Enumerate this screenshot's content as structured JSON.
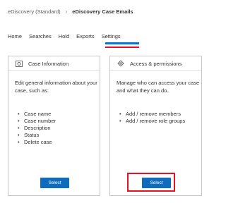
{
  "breadcrumb": {
    "parent": "eDiscovery (Standard)",
    "separator": "›",
    "current": "eDiscovery Case Emails"
  },
  "tabs": [
    {
      "label": "Home"
    },
    {
      "label": "Searches"
    },
    {
      "label": "Hold"
    },
    {
      "label": "Exports"
    },
    {
      "label": "Settings",
      "active": true
    }
  ],
  "cards": {
    "case_info": {
      "title": "Case Information",
      "icon": "info-card-icon",
      "description": "Edit general information about your case, such as:",
      "items": [
        "Case name",
        "Case number",
        "Description",
        "Status",
        "Delete case"
      ],
      "button": "Select"
    },
    "access": {
      "title": "Access & permissions",
      "icon": "key-icon",
      "description": "Manage who can access your case and what they can do.",
      "items": [
        "Add / remove members",
        "Add / remove role groups"
      ],
      "button": "Select"
    }
  },
  "colors": {
    "accent": "#0f6cbd",
    "tab_underline": "#0078d4",
    "highlight": "#e81123"
  }
}
